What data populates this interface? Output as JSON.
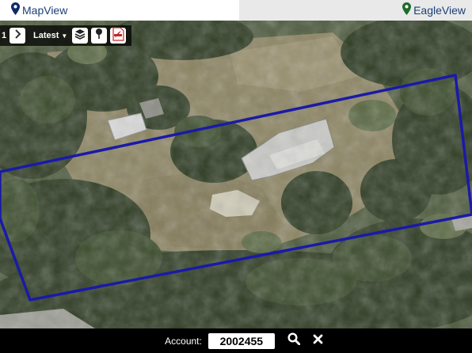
{
  "tabs": {
    "left_label": "MapView",
    "right_label": "EagleView",
    "pin_color_left": "#0d2a66",
    "pin_color_right": "#1e6b2a"
  },
  "toolbar": {
    "prefix_digit": "1",
    "next_icon": "chevron-right-icon",
    "latest_label": "Latest",
    "layers_icon": "layers-icon",
    "pin_icon": "map-pin-icon",
    "pdf_icon": "pdf-icon"
  },
  "map": {
    "parcel_color": "#1a1aa8"
  },
  "footer": {
    "account_label": "Account:",
    "account_value": "2002455",
    "search_icon": "search-icon",
    "clear_icon": "close-icon"
  }
}
